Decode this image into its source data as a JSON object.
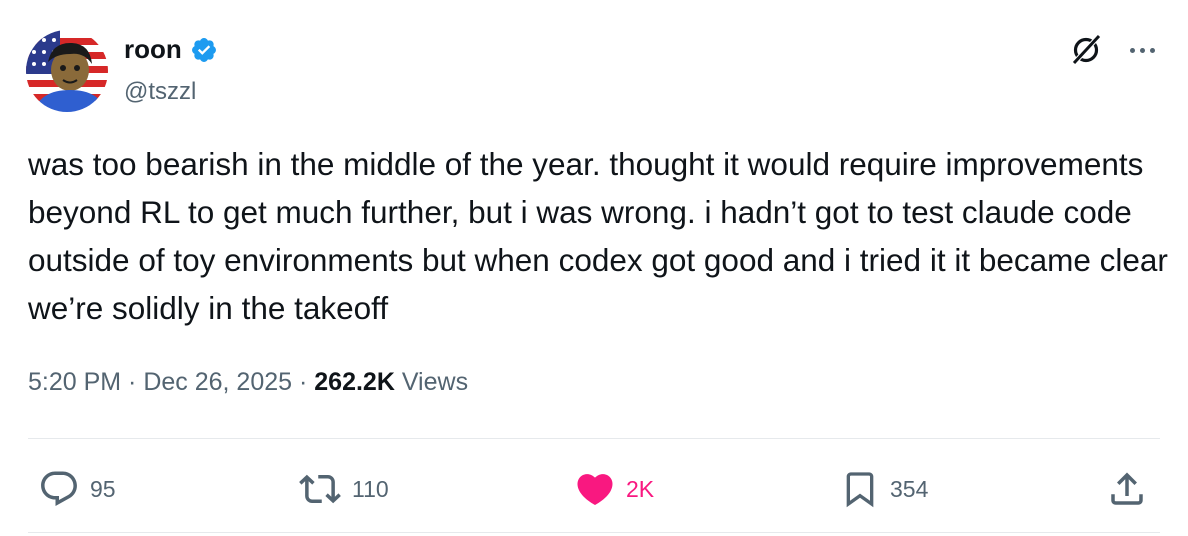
{
  "author": {
    "display_name": "roon",
    "handle": "@tszzl",
    "verified": true
  },
  "tweet": {
    "text": "was too bearish in the middle of the year. thought it would require improvements beyond RL to get much further, but i was wrong. i hadn’t got to test claude code outside of toy environments but when codex got good and i tried it it became clear we’re solidly in the takeoff"
  },
  "meta": {
    "time": "5:20 PM",
    "separator1": " · ",
    "date": "Dec 26, 2025",
    "separator2": " · ",
    "views_count": "262.2K",
    "views_label": " Views"
  },
  "actions": {
    "replies": "95",
    "reposts": "110",
    "likes": "2K",
    "bookmarks": "354"
  },
  "colors": {
    "text_primary": "#0f1419",
    "text_secondary": "#536471",
    "verified_blue": "#1d9bf0",
    "like_pink": "#f91880",
    "divider": "#e6e9ec"
  },
  "icons": [
    "verified-badge-icon",
    "grok-icon",
    "more-icon",
    "reply-icon",
    "repost-icon",
    "like-icon",
    "bookmark-icon",
    "share-icon"
  ]
}
